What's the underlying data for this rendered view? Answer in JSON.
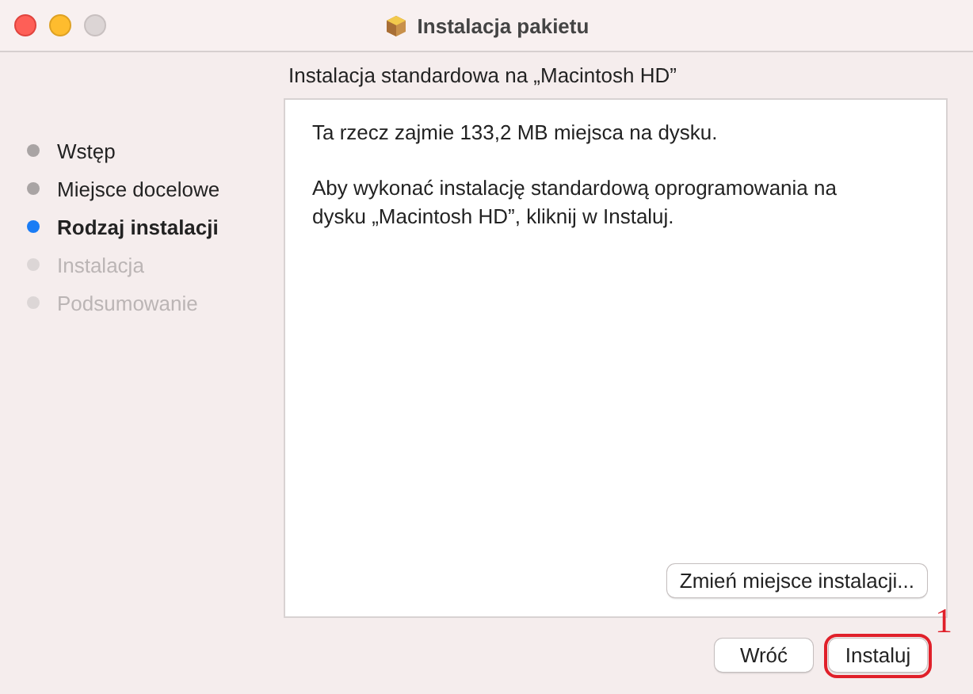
{
  "window": {
    "title": "Instalacja pakietu"
  },
  "header": "Instalacja standardowa na „Macintosh HD”",
  "steps": [
    {
      "label": "Wstęp",
      "selected": false,
      "disabled": false
    },
    {
      "label": "Miejsce docelowe",
      "selected": false,
      "disabled": false
    },
    {
      "label": "Rodzaj instalacji",
      "selected": true,
      "disabled": false
    },
    {
      "label": "Instalacja",
      "selected": false,
      "disabled": true
    },
    {
      "label": "Podsumowanie",
      "selected": false,
      "disabled": true
    }
  ],
  "content": {
    "paragraphs": [
      "Ta rzecz zajmie 133,2 MB miejsca na dysku.",
      "Aby wykonać instalację standardową oprogramowania na dysku „Macintosh HD”, kliknij w Instaluj."
    ],
    "change_button": "Zmień miejsce instalacji..."
  },
  "buttons": [
    {
      "label": "Wróć"
    },
    {
      "label": "Instaluj",
      "annotation": "1"
    }
  ]
}
